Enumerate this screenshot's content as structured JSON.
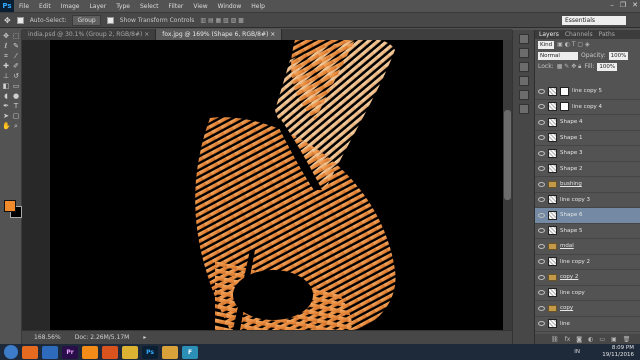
{
  "app": {
    "logo": "Ps"
  },
  "menu": [
    "File",
    "Edit",
    "Image",
    "Layer",
    "Type",
    "Select",
    "Filter",
    "View",
    "Window",
    "Help"
  ],
  "window_controls": [
    "minimize-icon",
    "restore-icon",
    "close-icon"
  ],
  "options": {
    "auto_select": "Auto-Select:",
    "group_select": "Group",
    "show_transform": "Show Transform Controls",
    "workspace": "Essentials"
  },
  "tabs": [
    "india.psd @ 30.1% (Group 2, RGB/8#) ×",
    "fox.jpg @ 169% (Shape 6, RGB/8#) ×"
  ],
  "status": {
    "zoom": "168.56%",
    "doc": "Doc: 2.26M/5.17M"
  },
  "colors": {
    "foreground": "#f18a2b",
    "background": "#000000",
    "selected_layer": "#7389a4"
  },
  "panel": {
    "tabs": [
      "Layers",
      "Channels",
      "Paths"
    ],
    "kind": "Kind",
    "blend_mode": "Normal",
    "opacity_label": "Opacity:",
    "opacity": "100%",
    "lock_label": "Lock:",
    "fill_label": "Fill:",
    "fill": "100%"
  },
  "layers": [
    {
      "name": "line copy 5",
      "type": "mask"
    },
    {
      "name": "line copy 4",
      "type": "mask"
    },
    {
      "name": "Shape 4",
      "type": "shape"
    },
    {
      "name": "Shape 1",
      "type": "shape"
    },
    {
      "name": "Shape 3",
      "type": "shape"
    },
    {
      "name": "Shape 2",
      "type": "shape"
    },
    {
      "name": "bushing",
      "type": "group"
    },
    {
      "name": "line copy 3",
      "type": "shape"
    },
    {
      "name": "Shape 6",
      "type": "shape",
      "selected": true
    },
    {
      "name": "Shape 5",
      "type": "shape"
    },
    {
      "name": "mdal",
      "type": "group"
    },
    {
      "name": "line copy 2",
      "type": "shape"
    },
    {
      "name": "copy 2",
      "type": "group"
    },
    {
      "name": "line copy",
      "type": "shape"
    },
    {
      "name": "copy",
      "type": "group"
    },
    {
      "name": "line",
      "type": "shape"
    }
  ],
  "taskbar": {
    "apps": [
      "firefox",
      "windows-explorer",
      "premiere",
      "vlc",
      "firefox-2",
      "chrome",
      "photoshop",
      "folder",
      "figma"
    ],
    "lang": "IN",
    "time": "8:09 PM",
    "date": "19/11/2016"
  }
}
